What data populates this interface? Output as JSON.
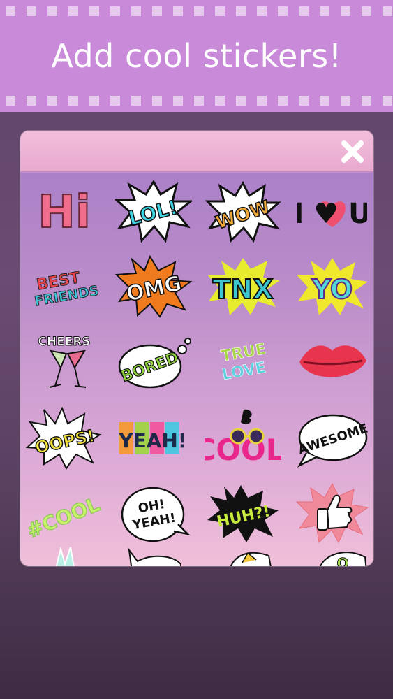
{
  "header": {
    "title": "Add cool stickers!"
  },
  "panel": {
    "close_icon": "close-icon",
    "stickers": [
      {
        "id": "hi",
        "text": "Hi"
      },
      {
        "id": "lol",
        "text": "LOL!"
      },
      {
        "id": "wow",
        "text": "WOW"
      },
      {
        "id": "i-love-u",
        "text": "I ♥ U"
      },
      {
        "id": "best-friends",
        "line1": "BEST",
        "line2": "FRIENDS"
      },
      {
        "id": "omg",
        "text": "OMG"
      },
      {
        "id": "tnx",
        "text": "TNX"
      },
      {
        "id": "yo",
        "text": "YO"
      },
      {
        "id": "cheers",
        "text": "CHEERS"
      },
      {
        "id": "bored",
        "text": "BORED"
      },
      {
        "id": "true-love",
        "line1": "TRUE",
        "line2": "LOVE"
      },
      {
        "id": "kiss-lips",
        "text": ""
      },
      {
        "id": "oops",
        "text": "OOPS!"
      },
      {
        "id": "yeah",
        "text": "YEAH!"
      },
      {
        "id": "cool-glasses",
        "text": "COOL"
      },
      {
        "id": "awesome",
        "text": "AWESOME"
      },
      {
        "id": "hashtag-cool",
        "text": "#COOL"
      },
      {
        "id": "oh-yeah",
        "line1": "OH!",
        "line2": "YEAH!"
      },
      {
        "id": "huh",
        "text": "HUH?!"
      },
      {
        "id": "thumbs-up",
        "text": ""
      }
    ]
  },
  "colors": {
    "banner": "#c98ad9",
    "panel_top": "#a77cc7",
    "panel_bottom": "#f0bfd9",
    "header_strip": "#f3bedb"
  }
}
